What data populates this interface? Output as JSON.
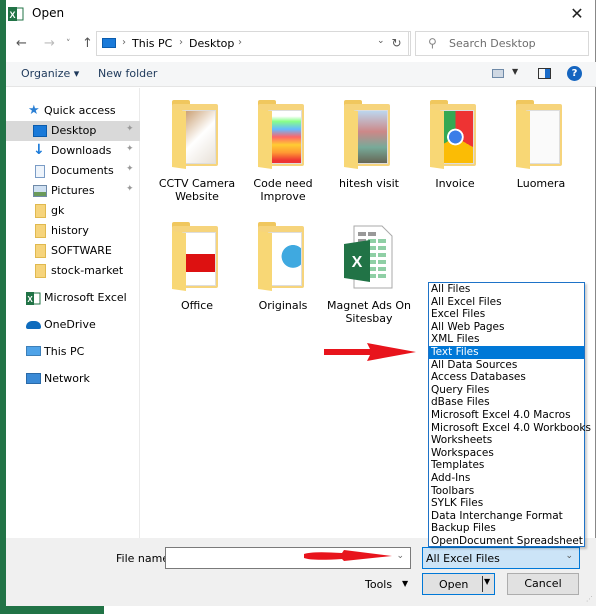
{
  "window": {
    "title": "Open",
    "close_glyph": "✕"
  },
  "navigation": {
    "back_glyph": "←",
    "forward_glyph": "→",
    "recent_glyph": "˅",
    "up_glyph": "↑",
    "breadcrumbs": [
      "This PC",
      "Desktop"
    ],
    "crumb_sep": "›",
    "dropdown_glyph": "⌄",
    "refresh_glyph": "↻",
    "search_placeholder": "Search Desktop",
    "search_glyph": "⚲"
  },
  "toolbar": {
    "organize_label": "Organize ▾",
    "new_folder_label": "New folder",
    "view_drop_glyph": "▼",
    "help_glyph": "?"
  },
  "sidebar": {
    "items": [
      {
        "label": "Quick access",
        "icon": "star-pin-icon"
      },
      {
        "label": "Desktop",
        "icon": "desktop-icon",
        "pinned": true,
        "selected": true
      },
      {
        "label": "Downloads",
        "icon": "download-arrow-icon",
        "pinned": true
      },
      {
        "label": "Documents",
        "icon": "documents-icon",
        "pinned": true
      },
      {
        "label": "Pictures",
        "icon": "pictures-icon",
        "pinned": true
      },
      {
        "label": "gk",
        "icon": "folder-icon"
      },
      {
        "label": "history",
        "icon": "folder-icon"
      },
      {
        "label": "SOFTWARE",
        "icon": "folder-icon"
      },
      {
        "label": "stock-market",
        "icon": "folder-icon"
      },
      {
        "label": "Microsoft Excel",
        "icon": "excel-icon"
      },
      {
        "label": "OneDrive",
        "icon": "cloud-icon"
      },
      {
        "label": "This PC",
        "icon": "computer-icon"
      },
      {
        "label": "Network",
        "icon": "network-icon"
      }
    ],
    "pin_glyph": "📌"
  },
  "files": [
    {
      "label": "CCTV Camera Website",
      "type": "folder"
    },
    {
      "label": "Code need Improve",
      "type": "folder"
    },
    {
      "label": "hitesh visit",
      "type": "folder"
    },
    {
      "label": "Invoice",
      "type": "folder"
    },
    {
      "label": "Luomera",
      "type": "folder"
    },
    {
      "label": "Office",
      "type": "folder"
    },
    {
      "label": "Originals",
      "type": "folder"
    },
    {
      "label": "Magnet Ads On Sitesbay",
      "type": "excel-file"
    }
  ],
  "file_type_options": [
    "All Files",
    "All Excel Files",
    "Excel Files",
    "All Web Pages",
    "XML Files",
    "Text Files",
    "All Data Sources",
    "Access Databases",
    "Query Files",
    "dBase Files",
    "Microsoft Excel 4.0 Macros",
    "Microsoft Excel 4.0 Workbooks",
    "Worksheets",
    "Workspaces",
    "Templates",
    "Add-Ins",
    "Toolbars",
    "SYLK Files",
    "Data Interchange Format",
    "Backup Files",
    "OpenDocument Spreadsheet"
  ],
  "highlighted_option": "Text Files",
  "footer": {
    "file_name_label": "File name:",
    "file_name_value": "",
    "file_type_selected": "All Excel Files",
    "tools_label": "Tools",
    "open_label": "Open",
    "cancel_label": "Cancel",
    "drop_glyph": "⌄",
    "tri_glyph": "▼"
  },
  "colors": {
    "excel_green": "#217346",
    "selection_blue": "#0078d7",
    "annotation_red": "#e8141c"
  }
}
